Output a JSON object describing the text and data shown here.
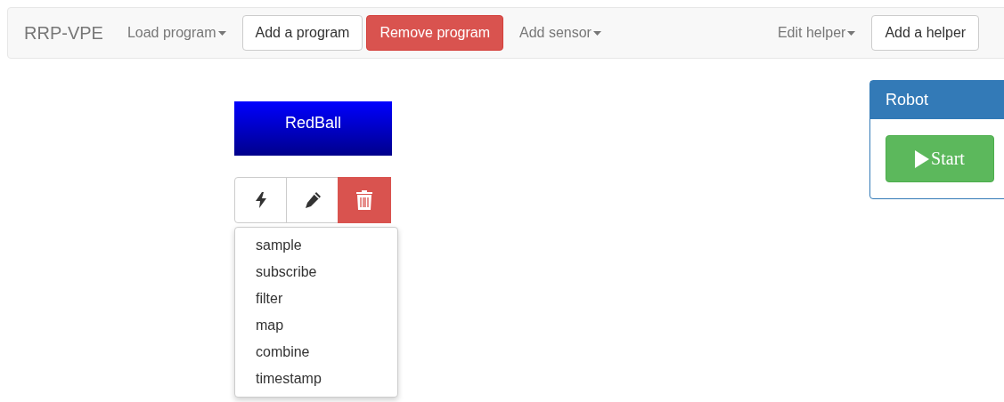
{
  "navbar": {
    "brand": "RRP-VPE",
    "items": [
      {
        "kind": "dropdown",
        "label": "Load program"
      },
      {
        "kind": "button",
        "label": "Add a program"
      },
      {
        "kind": "danger",
        "label": "Remove program"
      },
      {
        "kind": "dropdown",
        "label": "Add sensor"
      },
      {
        "kind": "spacer"
      },
      {
        "kind": "dropdown",
        "label": "Edit helper"
      },
      {
        "kind": "button",
        "label": "Add a helper"
      }
    ]
  },
  "node": {
    "label": "RedBall",
    "actions": [
      {
        "kind": "bolt"
      },
      {
        "kind": "pencil"
      },
      {
        "kind": "trash"
      }
    ],
    "menu": [
      "sample",
      "subscribe",
      "filter",
      "map",
      "combine",
      "timestamp"
    ]
  },
  "panel": {
    "title": "Robot",
    "button": "Start"
  }
}
